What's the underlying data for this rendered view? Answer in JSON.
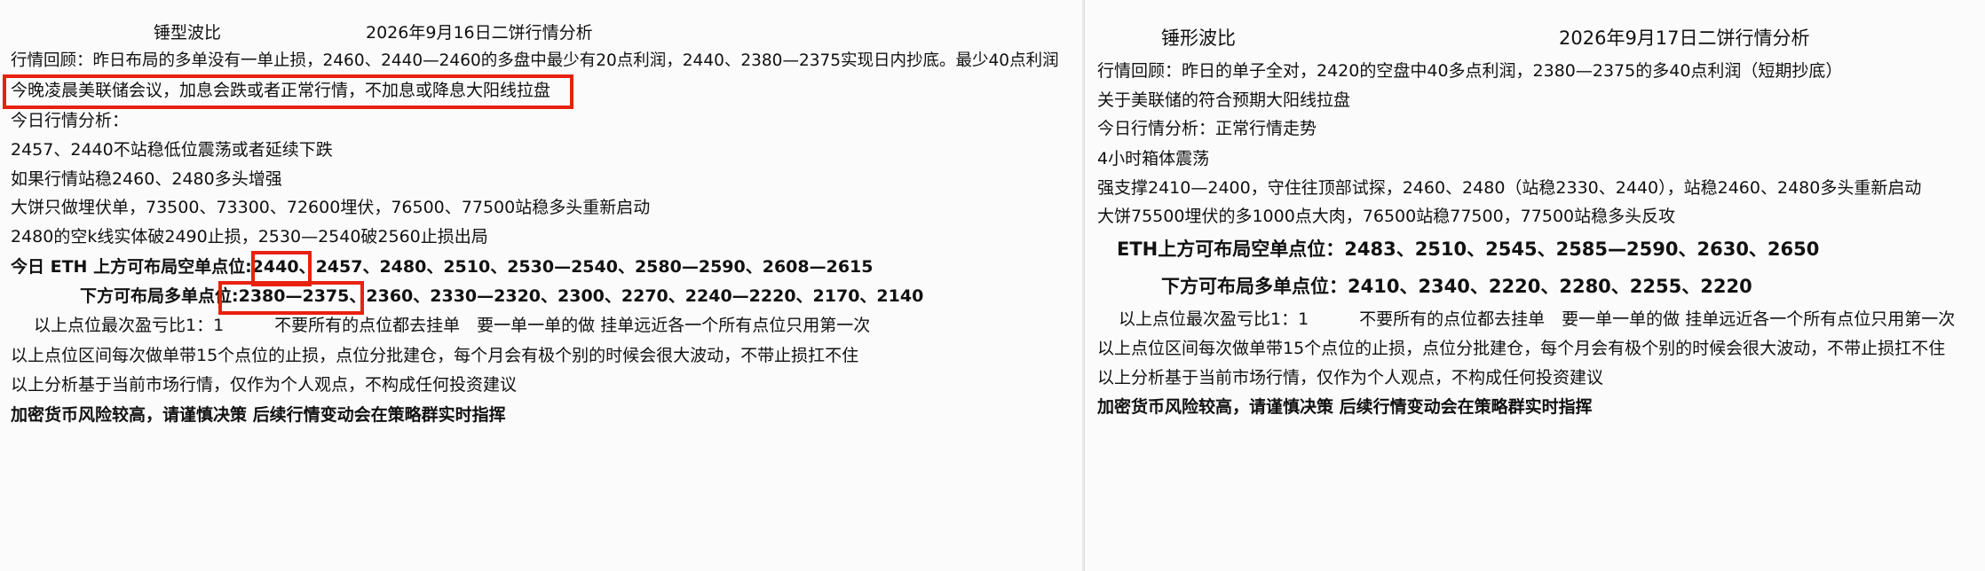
{
  "left": {
    "title_left": "锤型波比",
    "title_right": "2026年9月16日二饼行情分析",
    "review": "行情回顾：昨日布局的多单没有一单止损，2460、2440—2460的多盘中最少有20点利润，2440、2380—2375实现日内抄底。最少40点利润",
    "notice": "今晚凌晨美联储会议，加息会跌或者正常行情，不加息或降息大阳线拉盘",
    "analysis_heading": "今日行情分析：",
    "line1": "2457、2440不站稳低位震荡或者延续下跌",
    "line2": "如果行情站稳2460、2480多头增强",
    "line3": "大饼只做埋伏单，73500、73300、72600埋伏，76500、77500站稳多头重新启动",
    "line4": "2480的空k线实体破2490止损，2530—2540破2560止损出局",
    "short_label": "今日 ETH 上方可布局空单点位:",
    "short_highlight": "2440、",
    "short_rest": "2457、2480、2510、2530—2540、2580—2590、2608—2615",
    "long_label": "下方可布局多单点位:",
    "long_highlight": "2380—2375、",
    "long_rest": "2360、2330—2320、2300、2270、2240—2220、2170、2140",
    "ratio_line": "以上点位最次盈亏比1：1　　　不要所有的点位都去挂单　要一单一单的做 挂单远近各一个所有点位只用第一次",
    "stop_line": "以上点位区间每次做单带15个点位的止损，点位分批建仓，每个月会有极个别的时候会很大波动，不带止损扛不住",
    "disclaimer": "以上分析基于当前市场行情，仅作为个人观点，不构成任何投资建议",
    "risk": "加密货币风险较高，请谨慎决策 后续行情变动会在策略群实时指挥"
  },
  "right": {
    "title_left": "锤形波比",
    "title_right": "2026年9月17日二饼行情分析",
    "review": "行情回顾：昨日的单子全对，2420的空盘中40多点利润，2380—2375的多40点利润（短期抄底）",
    "line1": "关于美联储的符合预期大阳线拉盘",
    "analysis": "今日行情分析：正常行情走势",
    "line2": "4小时箱体震荡",
    "line3": "强支撑2410—2400，守住往顶部试探，2460、2480（站稳2330、2440），站稳2460、2480多头重新启动",
    "line4": "大饼75500埋伏的多1000点大肉，76500站稳77500，77500站稳多头反攻",
    "short_line": "ETH上方可布局空单点位：2483、2510、2545、2585—2590、2630、2650",
    "long_line": "下方可布局多单点位：2410、2340、2220、2280、2255、2220",
    "ratio_line": "以上点位最次盈亏比1：1　　　不要所有的点位都去挂单　要一单一单的做 挂单远近各一个所有点位只用第一次",
    "stop_line": "以上点位区间每次做单带15个点位的止损，点位分批建仓，每个月会有极个别的时候会很大波动，不带止损扛不住",
    "disclaimer": "以上分析基于当前市场行情，仅作为个人观点，不构成任何投资建议",
    "risk": "加密货币风险较高，请谨慎决策 后续行情变动会在策略群实时指挥"
  },
  "colors": {
    "highlight_border": "#e8210f",
    "text": "#111111"
  }
}
